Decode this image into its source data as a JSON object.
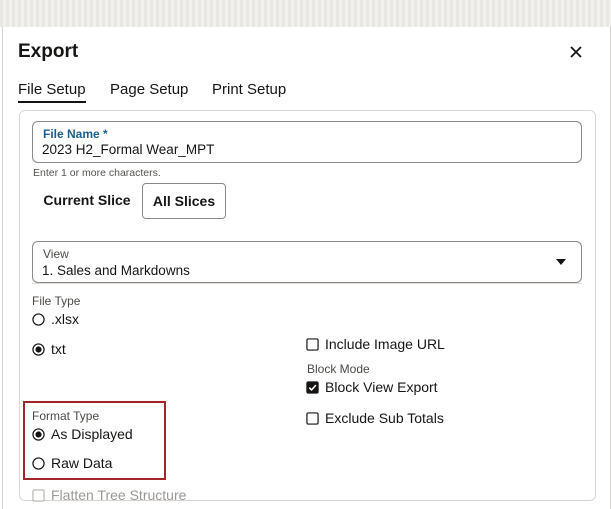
{
  "dialog": {
    "title": "Export"
  },
  "tabs": [
    {
      "label": "File Setup",
      "active": true
    },
    {
      "label": "Page Setup",
      "active": false
    },
    {
      "label": "Print Setup",
      "active": false
    }
  ],
  "file_name": {
    "label": "File Name *",
    "value": "2023 H2_Formal Wear_MPT",
    "hint": "Enter 1 or more characters."
  },
  "slices": {
    "current": "Current Slice",
    "all": "All Slices",
    "selected": "All Slices"
  },
  "view": {
    "label": "View",
    "value": "1. Sales and Markdowns"
  },
  "file_type": {
    "label": "File Type",
    "options": [
      {
        "label": ".xlsx",
        "selected": false
      },
      {
        "label": "txt",
        "selected": true
      }
    ]
  },
  "format_type": {
    "label": "Format Type",
    "options": [
      {
        "label": "As Displayed",
        "selected": true
      },
      {
        "label": "Raw Data",
        "selected": false
      }
    ]
  },
  "flatten": {
    "label": "Flatten Tree Structure",
    "checked": false,
    "disabled": true
  },
  "include_image_url": {
    "label": "Include Image URL",
    "checked": false
  },
  "block_mode": {
    "label": "Block Mode",
    "block_view_export": {
      "label": "Block View Export",
      "checked": true
    },
    "exclude_sub_totals": {
      "label": "Exclude Sub Totals",
      "checked": false
    }
  },
  "colors": {
    "highlight": "#a3272a",
    "label_blue": "#1b5e8e",
    "text": "#161513"
  }
}
